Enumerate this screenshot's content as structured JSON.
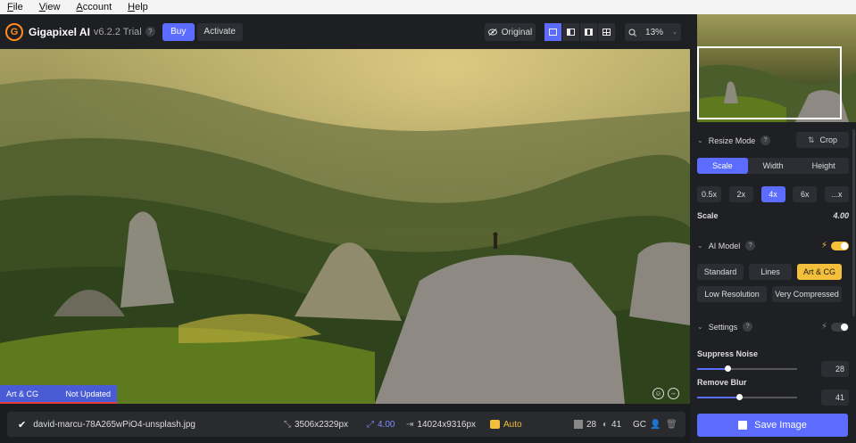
{
  "menu": [
    "File",
    "View",
    "Account",
    "Help"
  ],
  "app": {
    "logo_letter": "G",
    "name": "Gigapixel AI",
    "version": "v6.2.2 Trial",
    "help": "?",
    "buy": "Buy",
    "activate": "Activate"
  },
  "toolbar": {
    "original": "Original",
    "zoom": "13%",
    "view_modes": [
      "single",
      "split",
      "side-by-side",
      "grid"
    ],
    "active_view": "single"
  },
  "canvas": {
    "model_label": "Art & CG",
    "status": "Not Updated",
    "badge_color": "#4a5bd6",
    "status_line_color": "#e23b3b"
  },
  "filebar": {
    "filename": "david-marcu-78A265wPiO4-unsplash.jpg",
    "input_size": "3506x2329px",
    "scale": "4.00",
    "output_size": "14024x9316px",
    "auto": "Auto",
    "noise": "28",
    "blur": "41",
    "gc": "GC"
  },
  "panel": {
    "resize": {
      "title": "Resize Mode",
      "help": "?",
      "crop": "Crop",
      "tabs": [
        "Scale",
        "Width",
        "Height"
      ],
      "active_tab": "Scale",
      "chips": [
        "0.5x",
        "2x",
        "4x",
        "6x",
        "...x"
      ],
      "active_chip": "4x",
      "scale_label": "Scale",
      "scale_value": "4.00"
    },
    "model": {
      "title": "AI Model",
      "help": "?",
      "toggle": true,
      "buttons_row1": [
        "Standard",
        "Lines",
        "Art & CG"
      ],
      "active": "Art & CG",
      "buttons_row2": [
        "Low Resolution",
        "Very Compressed"
      ]
    },
    "settings": {
      "title": "Settings",
      "help": "?",
      "toggle": false,
      "sliders": [
        {
          "label": "Suppress Noise",
          "value": "28",
          "fraction": 0.3
        },
        {
          "label": "Remove Blur",
          "value": "41",
          "fraction": 0.42
        }
      ]
    },
    "save": "Save Image"
  },
  "colors": {
    "accent": "#5b6cff",
    "active_model": "#f4bf3a",
    "brand": "#ff8a1f"
  }
}
